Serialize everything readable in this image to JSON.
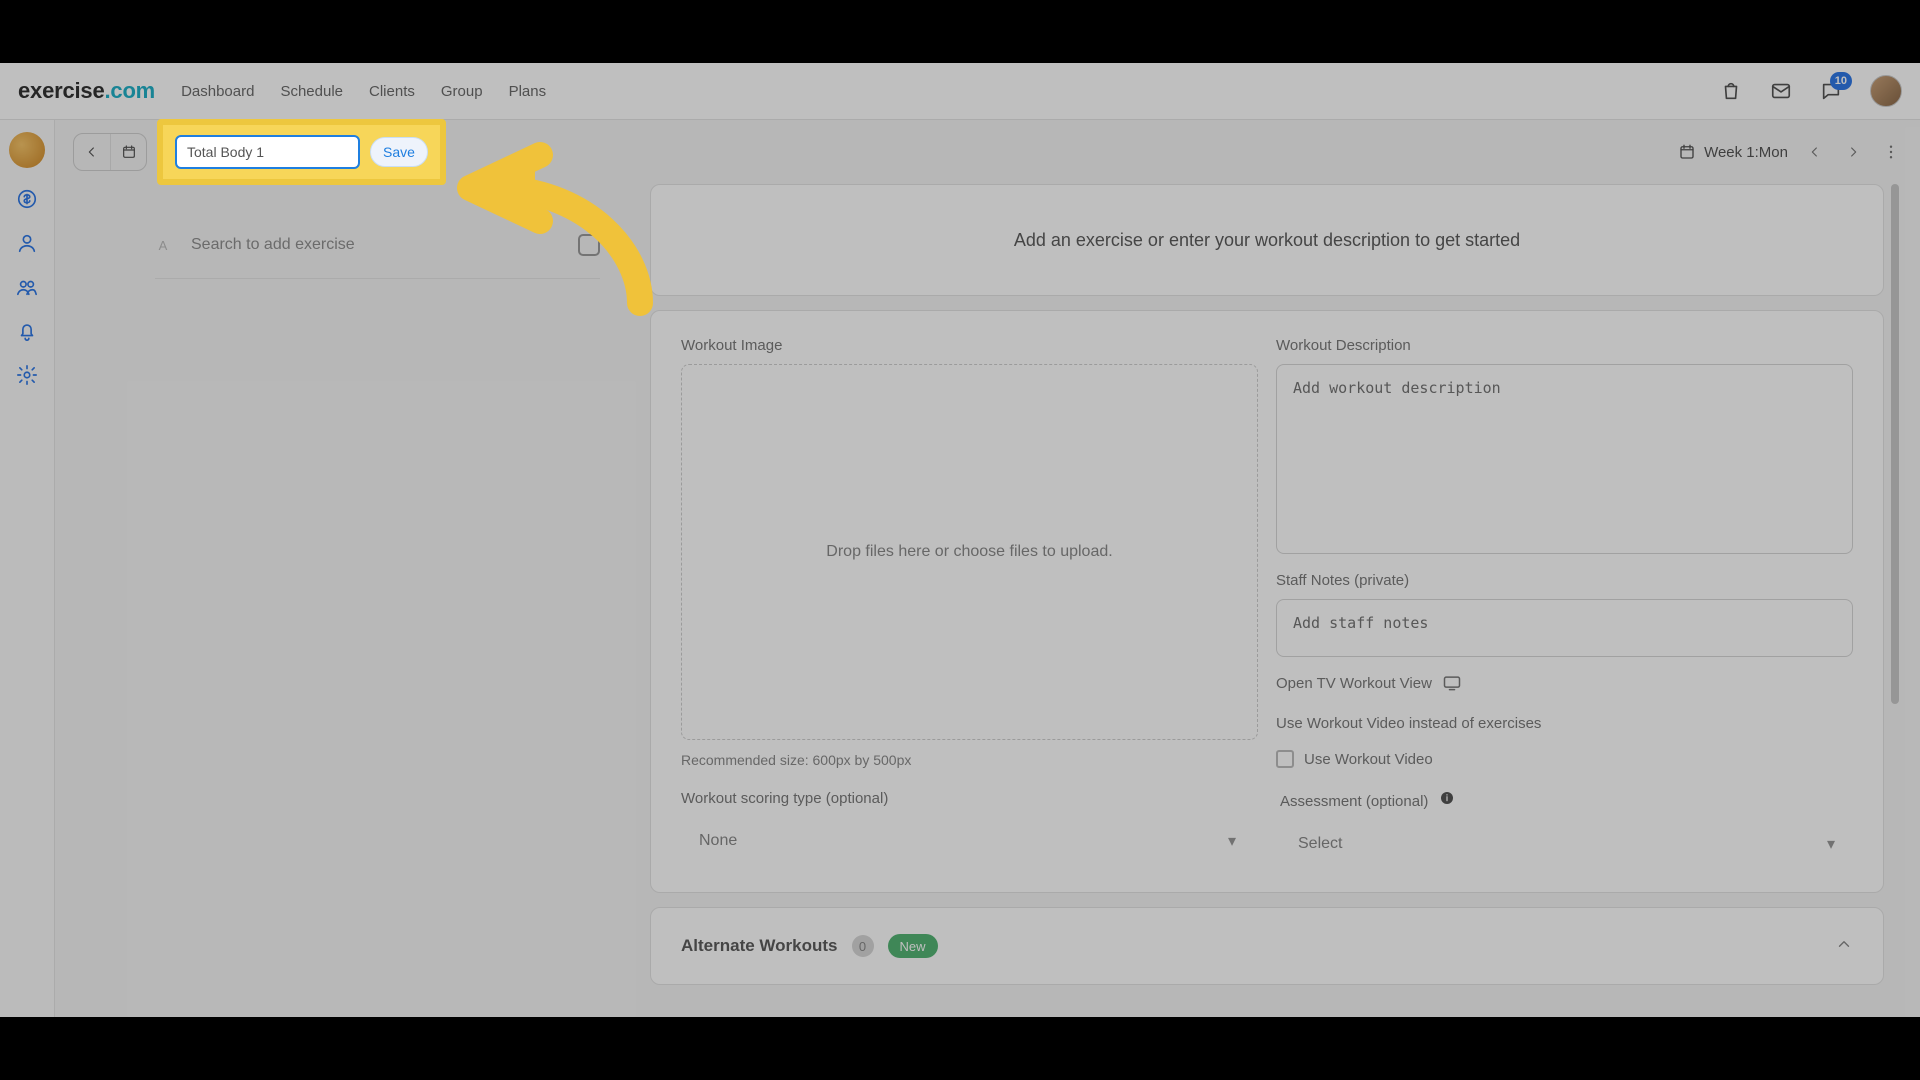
{
  "brand": {
    "part1": "exercise",
    "part2": ".com"
  },
  "nav": {
    "items": [
      "Dashboard",
      "Schedule",
      "Clients",
      "Group",
      "Plans"
    ]
  },
  "notifications": {
    "count": "10"
  },
  "toolbar": {
    "name_value": "Total Body 1",
    "save_label": "Save",
    "week_label": "Week 1:Mon"
  },
  "search": {
    "sort_hint": "A",
    "placeholder": "Search to add exercise"
  },
  "intro": {
    "text": "Add an exercise or enter your workout description to get started"
  },
  "form": {
    "image_label": "Workout Image",
    "image_drop_text": "Drop files here or choose files to upload.",
    "image_hint": "Recommended size: 600px by 500px",
    "desc_label": "Workout Description",
    "desc_placeholder": "Add workout description",
    "staff_label": "Staff Notes (private)",
    "staff_placeholder": "Add staff notes",
    "tv_label": "Open TV Workout View",
    "video_section_label": "Use Workout Video instead of exercises",
    "video_checkbox_label": "Use Workout Video"
  },
  "scoring": {
    "label": "Workout scoring type (optional)",
    "value": "None",
    "assessment_label": "Assessment (optional)",
    "assessment_value": "Select"
  },
  "alternate": {
    "title": "Alternate Workouts",
    "count": "0",
    "new": "New"
  }
}
